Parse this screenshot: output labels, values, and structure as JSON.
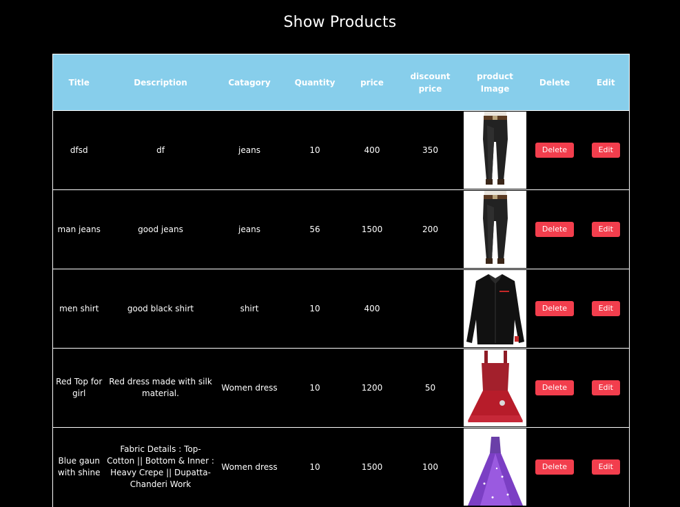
{
  "page": {
    "title": "Show Products"
  },
  "table": {
    "headers": [
      "Title",
      "Description",
      "Catagory",
      "Quantity",
      "price",
      "discount price",
      "product Image",
      "Delete",
      "Edit"
    ],
    "rows": [
      {
        "title": "dfsd",
        "description": "df",
        "category": "jeans",
        "quantity": "10",
        "price": "400",
        "discount_price": "350",
        "image_icon": "black-jeans-product-image",
        "delete_label": "Delete",
        "edit_label": "Edit"
      },
      {
        "title": "man jeans",
        "description": "good jeans",
        "category": "jeans",
        "quantity": "56",
        "price": "1500",
        "discount_price": "200",
        "image_icon": "black-jeans-product-image",
        "delete_label": "Delete",
        "edit_label": "Edit"
      },
      {
        "title": "men shirt",
        "description": "good black shirt",
        "category": "shirt",
        "quantity": "10",
        "price": "400",
        "discount_price": "",
        "image_icon": "black-shirt-product-image",
        "delete_label": "Delete",
        "edit_label": "Edit"
      },
      {
        "title": "Red Top for girl",
        "description": "Red dress made with silk material.",
        "category": "Women dress",
        "quantity": "10",
        "price": "1200",
        "discount_price": "50",
        "image_icon": "red-dress-product-image",
        "delete_label": "Delete",
        "edit_label": "Edit"
      },
      {
        "title": "Blue gaun with shine",
        "description": "Fabric Details : Top- Cotton || Bottom & Inner : Heavy Crepe || Dupatta- Chanderi Work",
        "category": "Women dress",
        "quantity": "10",
        "price": "1500",
        "discount_price": "100",
        "image_icon": "purple-gown-product-image",
        "delete_label": "Delete",
        "edit_label": "Edit"
      }
    ]
  },
  "colors": {
    "background": "#000000",
    "header_bg": "#87ceeb",
    "button_bg": "#f23e4d",
    "text": "#ffffff"
  }
}
